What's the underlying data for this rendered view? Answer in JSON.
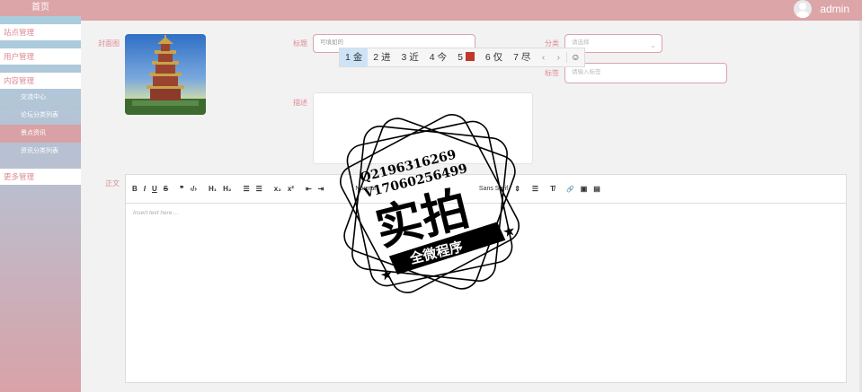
{
  "sidebar": {
    "home": "首页",
    "items": [
      "站点管理",
      "用户管理",
      "内容管理"
    ],
    "sub_items": [
      "交流中心",
      "论坛分类列表",
      "景点资讯",
      "资讯分类列表"
    ],
    "more": "更多管理"
  },
  "topbar": {
    "user": "admin"
  },
  "form": {
    "cover_label": "封面图",
    "title_label": "标题",
    "title_value": "可填如的",
    "category_label": "分类",
    "category_placeholder": "请选择",
    "tags_label": "标签",
    "tags_placeholder": "请输入标签",
    "desc_label": "描述",
    "body_label": "正文"
  },
  "ime": {
    "candidates": [
      "1 金",
      "2 进",
      "3 近",
      "4 今",
      "5",
      "6 仅",
      "7 尽"
    ],
    "prev": "‹",
    "next": "›",
    "emoji": "☺"
  },
  "editor": {
    "toolbar": {
      "bold": "B",
      "italic": "I",
      "underline": "U",
      "strike": "S",
      "quote": "❞",
      "code": "‹/›",
      "h1": "H₁",
      "h2": "H₂",
      "ol": "☰",
      "ul": "☰",
      "sub": "x₂",
      "sup": "x²",
      "outdent": "⇤",
      "indent": "⇥",
      "size": "Normal",
      "font": "Sans Serif",
      "font_arrow": "⇕",
      "align": "☰",
      "clean": "T̸",
      "link": "🔗",
      "image": "▣",
      "video": "▤"
    },
    "placeholder": "Insert text here ..."
  },
  "watermark": {
    "qq": "Q2196316269",
    "vx": "V17060256499",
    "main": "实拍",
    "banner": "全微程序"
  },
  "colors": {
    "accent": "#de8b90",
    "topbar": "#dca5a8"
  }
}
